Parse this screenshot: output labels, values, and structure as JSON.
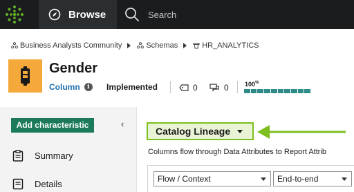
{
  "topbar": {
    "browse_label": "Browse",
    "search_placeholder": "Search"
  },
  "breadcrumb": [
    {
      "label": "Business Analysts Community"
    },
    {
      "label": "Schemas"
    },
    {
      "label": "HR_ANALYTICS"
    }
  ],
  "asset": {
    "title": "Gender",
    "type": "Column",
    "status": "Implemented",
    "tag_count": "0",
    "comment_count": "0",
    "completeness_label": "100",
    "completeness_unit": "%",
    "completeness_value": 1.0
  },
  "sidebar": {
    "add_button": "Add characteristic",
    "collapse_icon": "‹",
    "items": [
      {
        "label": "Summary"
      },
      {
        "label": "Details"
      }
    ]
  },
  "main": {
    "view_selector": "Catalog Lineage",
    "description": "Columns flow through Data Attributes to Report Attrib",
    "filter_flow": "Flow / Context",
    "filter_scope": "End-to-end"
  },
  "colors": {
    "accent_green": "#7dbf1f",
    "brand_green": "#1c7a5a",
    "asset_orange": "#f5a93a",
    "link_blue": "#1f6fae"
  }
}
